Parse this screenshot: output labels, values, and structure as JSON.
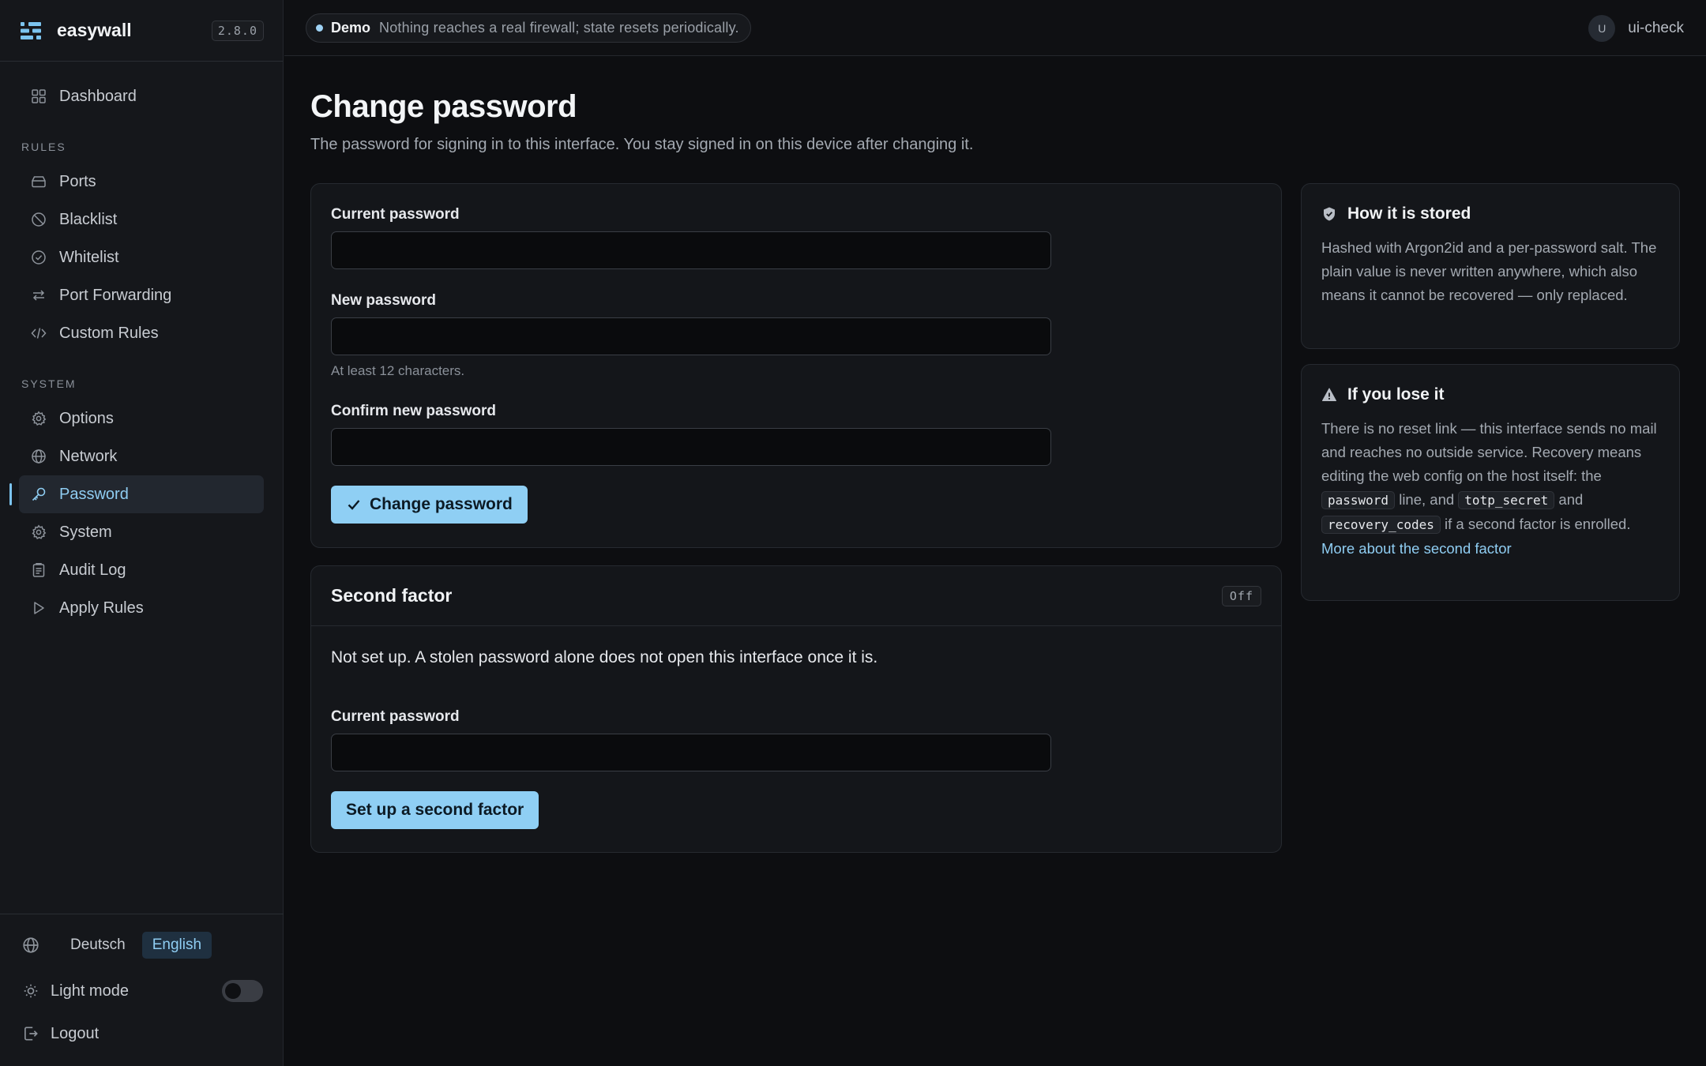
{
  "brand": {
    "name": "easywall",
    "version": "2.8.0"
  },
  "nav": {
    "dashboard": "Dashboard",
    "rules_heading": "RULES",
    "rules": [
      "Ports",
      "Blacklist",
      "Whitelist",
      "Port Forwarding",
      "Custom Rules"
    ],
    "system_heading": "SYSTEM",
    "system": [
      "Options",
      "Network",
      "Password",
      "System",
      "Audit Log",
      "Apply Rules"
    ],
    "active": "Password"
  },
  "footer": {
    "languages": [
      "Deutsch",
      "English"
    ],
    "active_language": "English",
    "light_mode_label": "Light mode",
    "light_mode_on": false,
    "logout_label": "Logout"
  },
  "topbar": {
    "demo_tag": "Demo",
    "demo_message": "Nothing reaches a real firewall; state resets periodically.",
    "avatar_initial": "U",
    "username": "ui-check"
  },
  "page": {
    "title": "Change password",
    "subtitle": "The password for signing in to this interface. You stay signed in on this device after changing it."
  },
  "form": {
    "current_label": "Current password",
    "current_value": "",
    "new_label": "New password",
    "new_value": "",
    "new_hint": "At least 12 characters.",
    "confirm_label": "Confirm new password",
    "confirm_value": "",
    "submit_label": "Change password"
  },
  "second_factor": {
    "title": "Second factor",
    "status": "Off",
    "description": "Not set up. A stolen password alone does not open this interface once it is.",
    "current_label": "Current password",
    "current_value": "",
    "setup_label": "Set up a second factor"
  },
  "stored_card": {
    "title": "How it is stored",
    "body": "Hashed with Argon2id and a per-password salt. The plain value is never written anywhere, which also means it cannot be recovered — only replaced."
  },
  "lose_card": {
    "title": "If you lose it",
    "body_1": "There is no reset link — this interface sends no mail and reaches no outside service. Recovery means editing the web config on the host itself: the",
    "code_1": "password",
    "body_2": "line, and",
    "code_2": "totp_secret",
    "body_3": "and",
    "code_3": "recovery_codes",
    "body_4": "if a second factor is enrolled.",
    "link": "More about the second factor"
  },
  "colors": {
    "accent": "#8fcff4",
    "background": "#0d0e11",
    "sidebar": "#15171b"
  }
}
